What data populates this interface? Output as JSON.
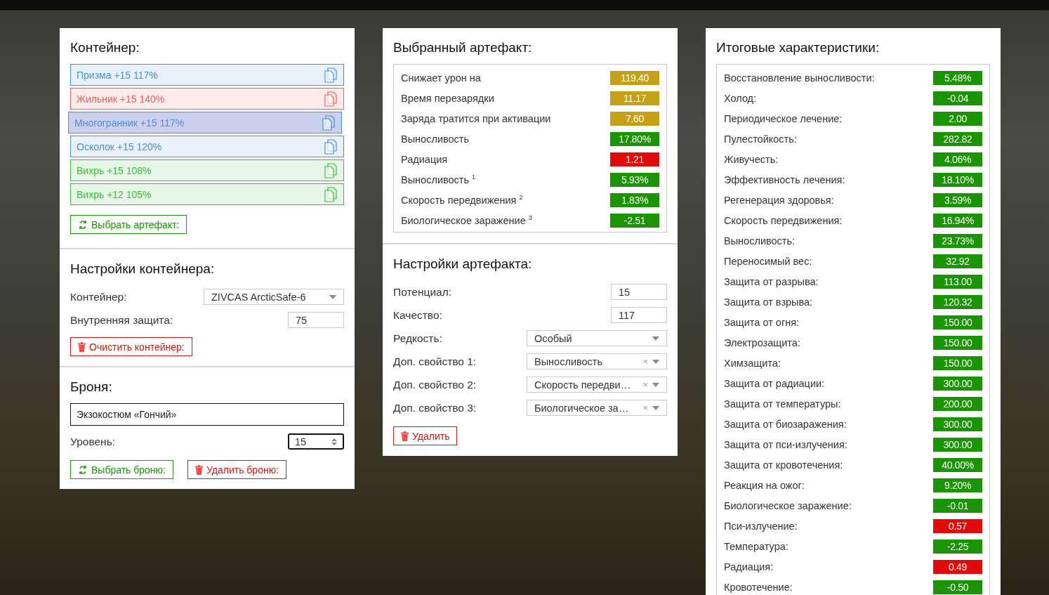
{
  "container_panel": {
    "title": "Контейнер:",
    "artifacts": [
      {
        "label": "Призма +15 117%",
        "color": "#4a8fdc",
        "selected": false
      },
      {
        "label": "Жильник +15 140%",
        "color": "#f25b5b",
        "selected": false
      },
      {
        "label": "Многогранник +15 117%",
        "color": "#4a8fdc",
        "selected": true
      },
      {
        "label": "Осколок +15 120%",
        "color": "#4a8fdc",
        "selected": false
      },
      {
        "label": "Вихрь +15 108%",
        "color": "#3cbb3c",
        "selected": false
      },
      {
        "label": "Вихрь +12 105%",
        "color": "#3cbb3c",
        "selected": false
      }
    ],
    "pick_button": "Выбрать артефакт:",
    "settings": {
      "title": "Настройки контейнера:",
      "container_label": "Контейнер:",
      "container_value": "ZIVCAS ArcticSafe-6",
      "protection_label": "Внутренняя защита:",
      "protection_value": "75",
      "clear_button": "Очистить контейнер:"
    },
    "armor": {
      "title": "Броня:",
      "name": "Экзокостюм «Гончий»",
      "level_label": "Уровень:",
      "level_value": "15",
      "pick_button": "Выбрать броню:",
      "delete_button": "Удалить броню:"
    }
  },
  "artifact_panel": {
    "title": "Выбранный артефакт:",
    "stats": [
      {
        "label": "Снижает урон на",
        "value": "119.40",
        "color": "#c6a117"
      },
      {
        "label": "Время перезарядки",
        "value": "11.17",
        "color": "#c6a117"
      },
      {
        "label": "Заряда тратится при активации",
        "value": "7.60",
        "color": "#c6a117"
      },
      {
        "label": "Выносливость",
        "value": "17.80%",
        "color": "#1a9402"
      },
      {
        "label": "Радиация",
        "value": "1.21",
        "color": "#e10b0b"
      },
      {
        "label": "Выносливость $^{1}$",
        "value": "5.93%",
        "color": "#1a9402"
      },
      {
        "label": "Скорость передвижения $^{2}$",
        "value": "1.83%",
        "color": "#1a9402"
      },
      {
        "label": "Биологическое заражение $^{3}$",
        "value": "-2.51",
        "color": "#1a9402"
      }
    ],
    "settings": {
      "title": "Настройки артефакта:",
      "fields": [
        {
          "kind": "input",
          "label": "Потенциал:",
          "value": "15"
        },
        {
          "kind": "input",
          "label": "Качество:",
          "value": "117"
        },
        {
          "kind": "select",
          "label": "Редкость:",
          "value": "Особый"
        },
        {
          "kind": "select",
          "label": "Доп. свойство 1:",
          "value": "Выносливость",
          "clear": "×"
        },
        {
          "kind": "select",
          "label": "Доп. свойство 2:",
          "value": "Скорость передви…",
          "clear": "×"
        },
        {
          "kind": "select",
          "label": "Доп. свойство 3:",
          "value": "Биологическое за…",
          "clear": "×"
        }
      ],
      "delete_button": "Удалить"
    }
  },
  "summary_panel": {
    "title": "Итоговые характеристики:",
    "stats": [
      {
        "label": "Восстановление выносливости:",
        "value": "5.48%",
        "color": "#1a9402"
      },
      {
        "label": "Холод:",
        "value": "-0.04",
        "color": "#1a9402"
      },
      {
        "label": "Периодическое лечение:",
        "value": "2.00",
        "color": "#1a9402"
      },
      {
        "label": "Пулестойкость:",
        "value": "282.82",
        "color": "#1a9402"
      },
      {
        "label": "Живучесть:",
        "value": "4.06%",
        "color": "#1a9402"
      },
      {
        "label": "Эффективность лечения:",
        "value": "18.10%",
        "color": "#1a9402"
      },
      {
        "label": "Регенерация здоровья:",
        "value": "3.59%",
        "color": "#1a9402"
      },
      {
        "label": "Скорость передвижения:",
        "value": "16.94%",
        "color": "#1a9402"
      },
      {
        "label": "Выносливость:",
        "value": "23.73%",
        "color": "#1a9402"
      },
      {
        "label": "Переносимый вес:",
        "value": "32.92",
        "color": "#1a9402"
      },
      {
        "label": "Защита от разрыва:",
        "value": "113.00",
        "color": "#1a9402"
      },
      {
        "label": "Защита от взрыва:",
        "value": "120.32",
        "color": "#1a9402"
      },
      {
        "label": "Защита от огня:",
        "value": "150.00",
        "color": "#1a9402"
      },
      {
        "label": "Электрозащита:",
        "value": "150.00",
        "color": "#1a9402"
      },
      {
        "label": "Химзащита:",
        "value": "150.00",
        "color": "#1a9402"
      },
      {
        "label": "Защита от радиации:",
        "value": "300.00",
        "color": "#1a9402"
      },
      {
        "label": "Защита от температуры:",
        "value": "200.00",
        "color": "#1a9402"
      },
      {
        "label": "Защита от биозаражения:",
        "value": "300.00",
        "color": "#1a9402"
      },
      {
        "label": "Защита от пси-излучения:",
        "value": "300.00",
        "color": "#1a9402"
      },
      {
        "label": "Защита от кровотечения:",
        "value": "40.00%",
        "color": "#1a9402"
      },
      {
        "label": "Реакция на ожог:",
        "value": "9.20%",
        "color": "#1a9402"
      },
      {
        "label": "Биологическое заражение:",
        "value": "-0.01",
        "color": "#1a9402"
      },
      {
        "label": "Пси-излучение:",
        "value": "0.57",
        "color": "#e10b0b"
      },
      {
        "label": "Температура:",
        "value": "-2.25",
        "color": "#1a9402"
      },
      {
        "label": "Радиация:",
        "value": "0.49",
        "color": "#e10b0b"
      },
      {
        "label": "Кровотечение:",
        "value": "-0.50",
        "color": "#1a9402"
      }
    ]
  }
}
